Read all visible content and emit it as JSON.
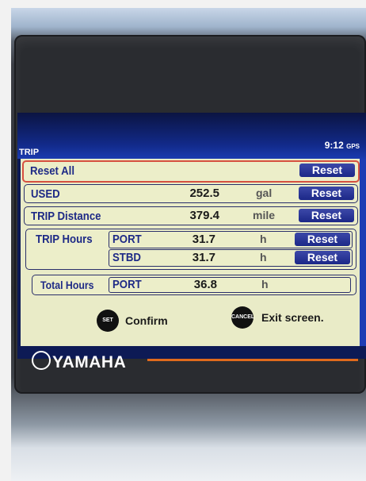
{
  "screen": {
    "title": "TRIP",
    "time": "9:12",
    "gps_label": "GPS"
  },
  "rows": {
    "reset_all": {
      "label": "Reset All",
      "button": "Reset"
    },
    "used": {
      "label": "USED",
      "value": "252.5",
      "unit": "gal",
      "button": "Reset"
    },
    "trip_distance": {
      "label": "TRIP Distance",
      "value": "379.4",
      "unit": "mile",
      "button": "Reset"
    },
    "trip_hours": {
      "label": "TRIP Hours",
      "port": {
        "label": "PORT",
        "value": "31.7",
        "unit": "h",
        "button": "Reset"
      },
      "stbd": {
        "label": "STBD",
        "value": "31.7",
        "unit": "h",
        "button": "Reset"
      }
    },
    "total_hours": {
      "label": "Total Hours",
      "port": {
        "label": "PORT",
        "value": "36.8",
        "unit": "h"
      }
    }
  },
  "footer": {
    "set_key": "SET",
    "confirm": "Confirm",
    "cancel_key": "CANCEL",
    "exit": "Exit screen."
  },
  "brand": {
    "name": "YAMAHA"
  },
  "colors": {
    "panel": "#e9ebc7",
    "label": "#1e2a86",
    "button": "#1c2888",
    "selection": "#d65040",
    "accent_line": "#e06a1c"
  }
}
